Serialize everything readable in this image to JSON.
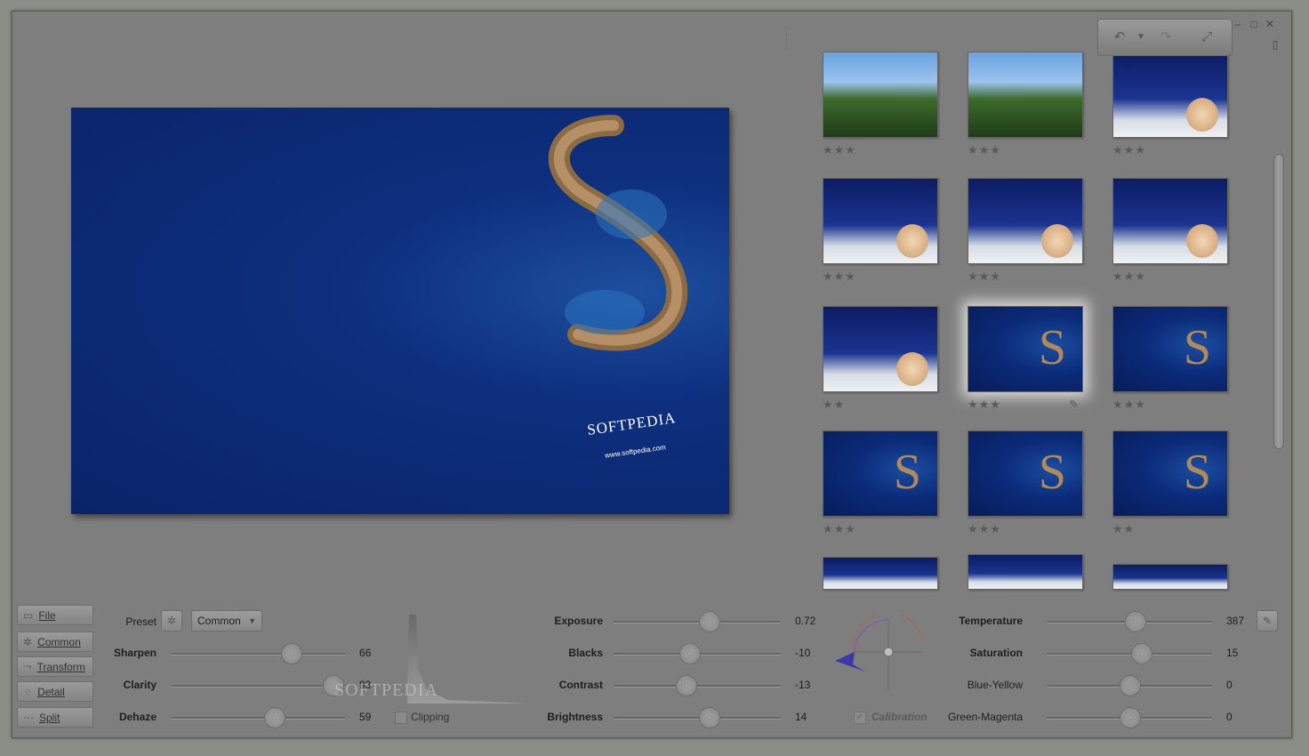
{
  "preview": {
    "brand": "SOFTPEDIA",
    "url": "www.softpedia.com"
  },
  "thumbnails": [
    {
      "kind": "forest",
      "stars": "★★★"
    },
    {
      "kind": "forest",
      "stars": "★★★"
    },
    {
      "kind": "portrait",
      "stars": "★★★"
    },
    {
      "kind": "portrait",
      "stars": "★★★"
    },
    {
      "kind": "portrait",
      "stars": "★★★"
    },
    {
      "kind": "portrait",
      "stars": "★★★"
    },
    {
      "kind": "portrait",
      "stars": "★★"
    },
    {
      "kind": "island",
      "stars": "★★★",
      "selected": true
    },
    {
      "kind": "island",
      "stars": "★★★"
    },
    {
      "kind": "island",
      "stars": "★★★"
    },
    {
      "kind": "island",
      "stars": "★★★"
    },
    {
      "kind": "island",
      "stars": "★★"
    }
  ],
  "nav": [
    "File",
    "Common",
    "Transform",
    "Detail",
    "Split"
  ],
  "preset": {
    "label": "Preset",
    "value": "Common"
  },
  "left_sliders": [
    {
      "label": "Sharpen",
      "value": "66",
      "level": 0.69
    },
    {
      "label": "Clarity",
      "value": "93",
      "level": 0.93
    },
    {
      "label": "Dehaze",
      "value": "59",
      "level": 0.59
    }
  ],
  "clipping": {
    "label": "Clipping"
  },
  "mid_sliders": [
    {
      "label": "Exposure",
      "value": "0.72",
      "level": 0.57
    },
    {
      "label": "Blacks",
      "value": "-10",
      "level": 0.45
    },
    {
      "label": "Contrast",
      "value": "-13",
      "level": 0.43
    },
    {
      "label": "Brightness",
      "value": "14",
      "level": 0.57
    }
  ],
  "calibration": {
    "label": "Calibration"
  },
  "right_sliders": [
    {
      "label": "Temperature",
      "value": "387",
      "level": 0.53
    },
    {
      "label": "Saturation",
      "value": "15",
      "level": 0.57
    },
    {
      "label": "Blue-Yellow",
      "value": "0",
      "level": 0.5
    },
    {
      "label": "Green-Magenta",
      "value": "0",
      "level": 0.5
    }
  ],
  "watermark": "SOFTPEDIA",
  "colors": {
    "accent": "#4a3fb0",
    "background": "#7e7e7e",
    "preview_blue": "#0d2f7e"
  }
}
